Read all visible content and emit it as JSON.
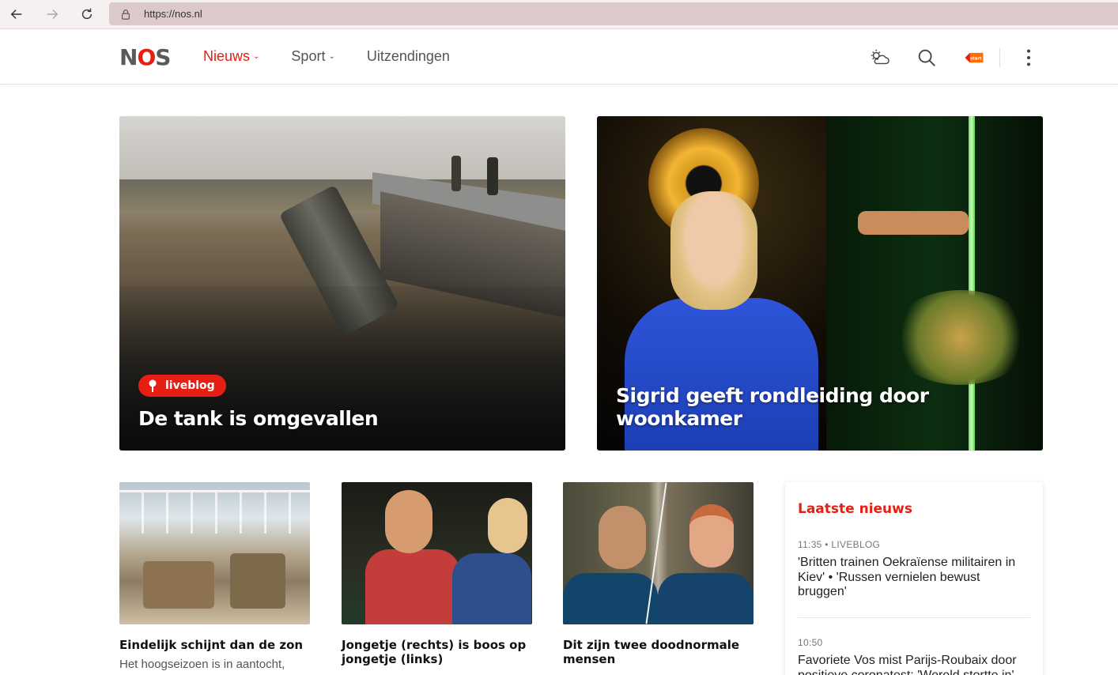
{
  "browser": {
    "url": "https://nos.nl"
  },
  "header": {
    "logo": "NOS",
    "nav": [
      {
        "label": "Nieuws",
        "active": true,
        "has_caret": true
      },
      {
        "label": "Sport",
        "active": false,
        "has_caret": true
      },
      {
        "label": "Uitzendingen",
        "active": false,
        "has_caret": false
      }
    ],
    "icons": [
      "weather-icon",
      "search-icon",
      "npo-start-icon",
      "more-vertical-icon"
    ],
    "npo_badge": "start"
  },
  "hero": [
    {
      "title": "De tank is omgevallen",
      "badge": "liveblog"
    },
    {
      "title": "Sigrid geeft rondleiding door woonkamer"
    }
  ],
  "cards": [
    {
      "title": "Eindelijk schijnt dan de zon",
      "subtitle": "Het hoogseizoen is in aantocht,"
    },
    {
      "title": "Jongetje (rechts) is boos op jongetje (links)",
      "subtitle": ""
    },
    {
      "title": "Dit zijn twee doodnormale mensen",
      "subtitle": ""
    }
  ],
  "latest": {
    "title": "Laatste nieuws",
    "items": [
      {
        "time": "11:35",
        "tag": "LIVEBLOG",
        "text": "'Britten trainen Oekraïense militairen in Kiev' • 'Russen vernielen bewust bruggen'"
      },
      {
        "time": "10:50",
        "tag": "",
        "text": "Favoriete Vos mist Parijs-Roubaix door positieve coronatest: 'Wereld stortte in'"
      }
    ]
  },
  "colors": {
    "brand_red": "#e61e14",
    "logo_grey": "#5a5a5a"
  }
}
